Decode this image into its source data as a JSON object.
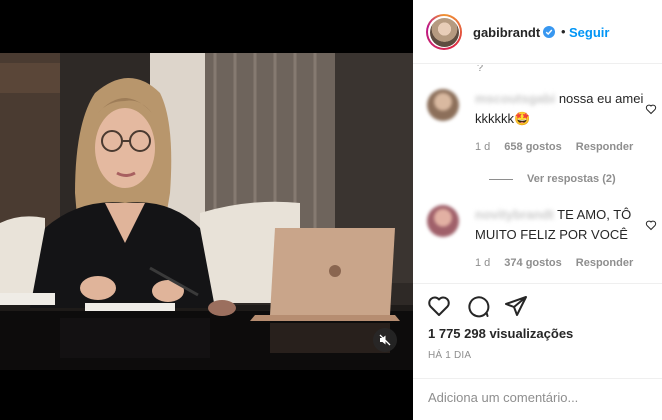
{
  "post": {
    "username": "gabibrandt",
    "separator": "•",
    "follow_label": "Seguir",
    "scroll_hint": "?"
  },
  "comments": [
    {
      "username": "mscoutsgabi",
      "text": "nossa eu amei kkkkkk",
      "emoji": "🤩",
      "age": "1 d",
      "likes": "658 gostos",
      "reply_label": "Responder",
      "view_replies": "Ver respostas (2)"
    },
    {
      "username": "novitybrandt",
      "text": "TE AMO, TÔ MUITO FELIZ POR VOCÊ",
      "age": "1 d",
      "likes": "374 gostos",
      "reply_label": "Responder"
    }
  ],
  "stats": {
    "views": "1 775 298 visualizações",
    "time": "HÁ 1 DIA"
  },
  "composer": {
    "placeholder": "Adiciona um comentário..."
  },
  "colors": {
    "accent": "#0095f6",
    "text": "#262626",
    "muted": "#8e8e8e",
    "divider": "#efefef"
  },
  "icons": {
    "verified": "verified-badge-icon",
    "like": "heart-icon",
    "comment": "comment-bubble-icon",
    "share": "paper-plane-icon",
    "mute": "speaker-muted-icon"
  }
}
